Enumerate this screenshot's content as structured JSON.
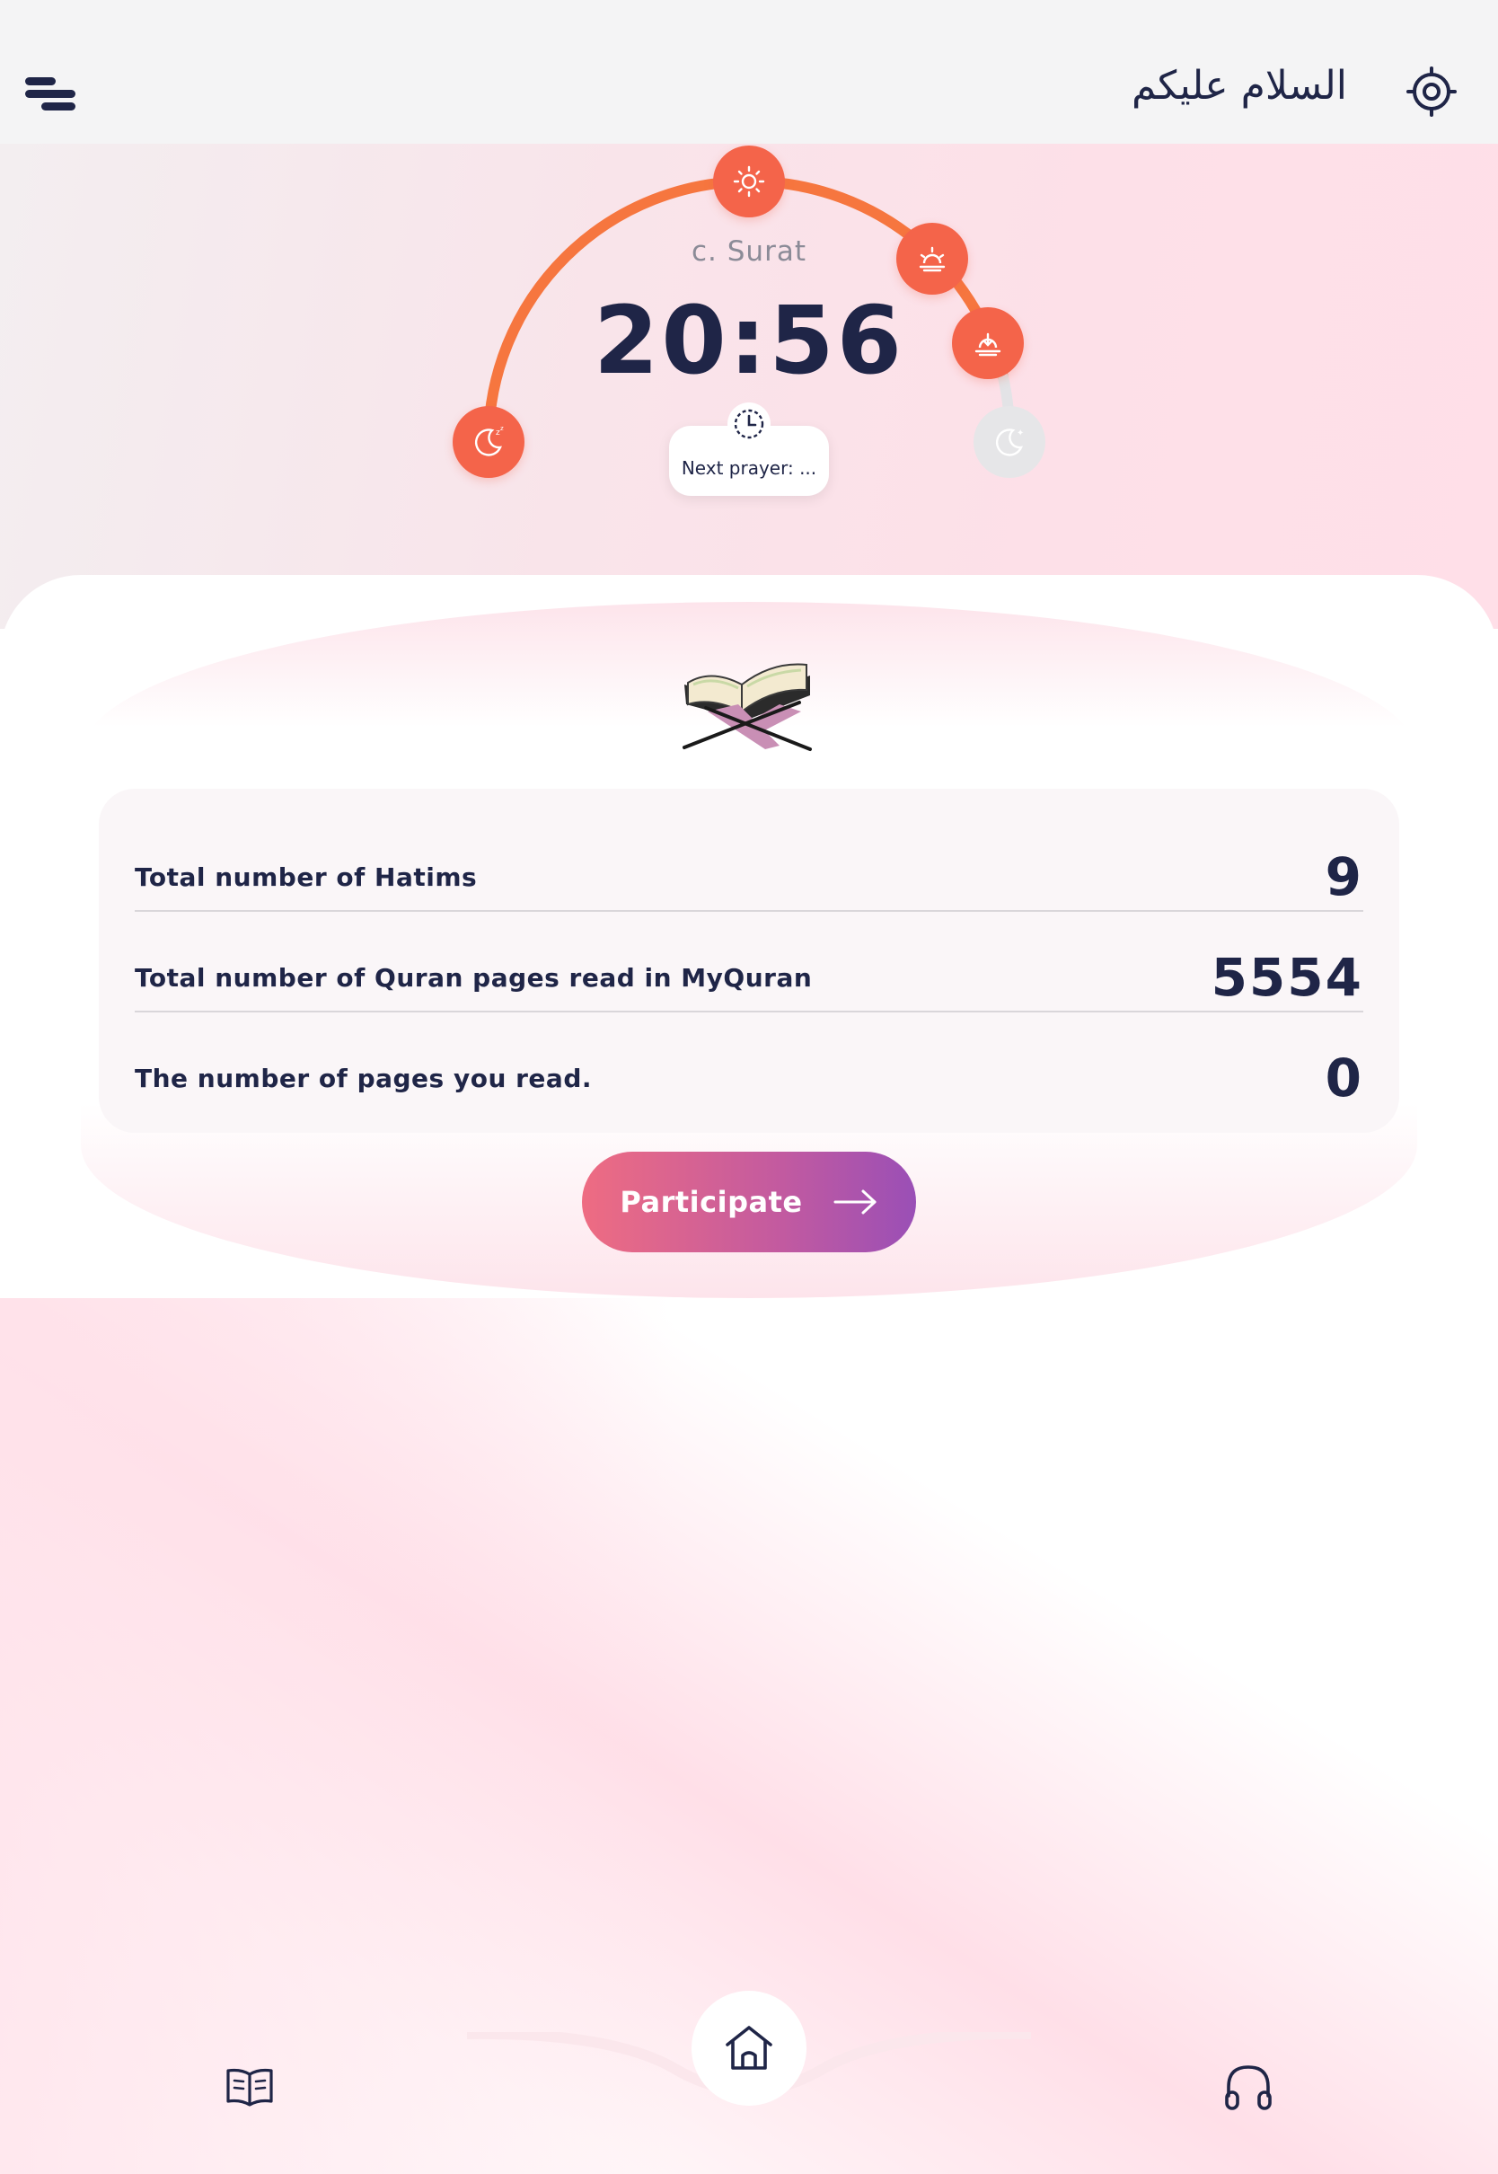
{
  "header": {
    "greeting": "السلام عليكم",
    "menu_icon": "menu-icon",
    "location_icon": "target-icon"
  },
  "prayer": {
    "city": "c. Surat",
    "time": "20:56",
    "next_prayer_label": "Next prayer: ...",
    "points": [
      {
        "icon": "moon-sleep-icon",
        "state": "active"
      },
      {
        "icon": "sun-icon",
        "state": "active"
      },
      {
        "icon": "sunset-icon",
        "state": "active"
      },
      {
        "icon": "sunset-down-icon",
        "state": "active"
      },
      {
        "icon": "moon-star-icon",
        "state": "inactive"
      }
    ],
    "accent_color": "#f4644a"
  },
  "stats": {
    "rows": [
      {
        "label": "Total number of Hatims",
        "value": "9"
      },
      {
        "label": "Total number of Quran pages read in MyQuran",
        "value": "5554"
      },
      {
        "label": "The number of pages you read.",
        "value": "0"
      }
    ]
  },
  "cta": {
    "label": "Participate"
  },
  "bottom_nav": {
    "items": [
      {
        "name": "quran",
        "icon": "open-book-icon"
      },
      {
        "name": "home",
        "icon": "home-icon",
        "active": true
      },
      {
        "name": "audio",
        "icon": "headphones-icon"
      }
    ]
  }
}
